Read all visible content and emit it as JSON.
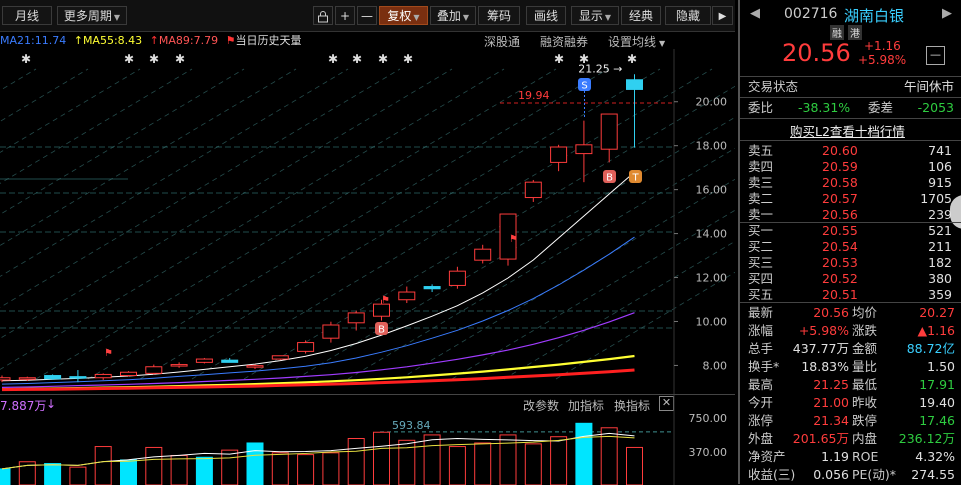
{
  "toolbar": {
    "monthly": "月线",
    "more_periods": "更多周期",
    "lock_icon": "lock-icon",
    "plus": "+",
    "minus": "—",
    "restore": "复权",
    "overlay": "叠加",
    "chips": "筹码",
    "draw": "画线",
    "display": "显示",
    "classic": "经典",
    "hide": "隐藏",
    "collapse": "▶"
  },
  "ma_legend": {
    "ma21": "MA21:11.74",
    "ma55": "MA55:8.43",
    "ma89": "MA89:7.79",
    "history": "当日历史天量",
    "ma21_color": "#3a7cff",
    "ma55_color": "#ffff33",
    "ma89_color": "#ff3333"
  },
  "chart_links": {
    "margin_link": "深股通",
    "financing": "融资融券",
    "set_ma": "设置均线"
  },
  "chart_data": {
    "type": "candlestick",
    "y_ticks": [
      "20.00",
      "18.00",
      "16.00",
      "14.00",
      "12.00",
      "10.00",
      "8.00"
    ],
    "ylim": [
      6.7,
      22.4
    ],
    "annotations": {
      "high_label": "21.25",
      "ref_label": "19.94",
      "mark_s": "S",
      "mark_b": "B",
      "mark_t": "T"
    },
    "candles": [
      {
        "o": 7.34,
        "h": 7.54,
        "l": 7.24,
        "c": 7.44
      },
      {
        "o": 7.39,
        "h": 7.49,
        "l": 7.29,
        "c": 7.44
      },
      {
        "o": 7.54,
        "h": 7.59,
        "l": 7.34,
        "c": 7.39
      },
      {
        "o": 7.49,
        "h": 7.79,
        "l": 7.24,
        "c": 7.44
      },
      {
        "o": 7.44,
        "h": 7.64,
        "l": 7.34,
        "c": 7.59
      },
      {
        "o": 7.54,
        "h": 7.74,
        "l": 7.49,
        "c": 7.69
      },
      {
        "o": 7.64,
        "h": 8.04,
        "l": 7.59,
        "c": 7.94
      },
      {
        "o": 8.04,
        "h": 8.14,
        "l": 7.89,
        "c": 8.04
      },
      {
        "o": 8.14,
        "h": 8.34,
        "l": 8.09,
        "c": 8.29
      },
      {
        "o": 8.24,
        "h": 8.34,
        "l": 8.14,
        "c": 8.14
      },
      {
        "o": 7.94,
        "h": 8.04,
        "l": 7.84,
        "c": 7.99
      },
      {
        "o": 8.29,
        "h": 8.44,
        "l": 8.24,
        "c": 8.44
      },
      {
        "o": 8.64,
        "h": 9.14,
        "l": 8.54,
        "c": 9.04
      },
      {
        "o": 9.24,
        "h": 9.99,
        "l": 9.04,
        "c": 9.84
      },
      {
        "o": 9.94,
        "h": 10.49,
        "l": 9.59,
        "c": 10.39
      },
      {
        "o": 10.24,
        "h": 10.99,
        "l": 10.04,
        "c": 10.79
      },
      {
        "o": 10.99,
        "h": 11.59,
        "l": 10.84,
        "c": 11.34
      },
      {
        "o": 11.59,
        "h": 11.69,
        "l": 11.34,
        "c": 11.49
      },
      {
        "o": 11.64,
        "h": 12.49,
        "l": 11.49,
        "c": 12.29
      },
      {
        "o": 12.79,
        "h": 13.49,
        "l": 12.64,
        "c": 13.29
      },
      {
        "o": 12.84,
        "h": 14.89,
        "l": 12.54,
        "c": 14.89
      },
      {
        "o": 15.64,
        "h": 16.44,
        "l": 15.44,
        "c": 16.34
      },
      {
        "o": 17.24,
        "h": 18.04,
        "l": 16.84,
        "c": 17.94
      },
      {
        "o": 17.64,
        "h": 19.14,
        "l": 16.34,
        "c": 18.04
      },
      {
        "o": 17.84,
        "h": 19.44,
        "l": 17.24,
        "c": 19.44
      },
      {
        "o": 21.0,
        "h": 21.25,
        "l": 17.91,
        "c": 20.56
      }
    ],
    "series": [
      {
        "values": [
          7.3,
          7.33,
          7.37,
          7.41,
          7.46,
          7.52,
          7.6,
          7.7,
          7.82,
          7.94,
          8.06,
          8.22,
          8.42,
          8.68,
          9.0,
          9.38,
          9.8,
          10.24,
          10.72,
          11.3,
          11.98,
          12.8,
          13.8,
          14.8,
          15.8,
          16.8
        ]
      },
      {
        "values": [
          7.15,
          7.18,
          7.22,
          7.26,
          7.3,
          7.35,
          7.42,
          7.5,
          7.58,
          7.66,
          7.74,
          7.84,
          7.96,
          8.12,
          8.34,
          8.6,
          8.9,
          9.24,
          9.6,
          10.02,
          10.5,
          11.04,
          11.66,
          12.34,
          13.06,
          13.84
        ]
      },
      {
        "values": [
          7.0,
          7.02,
          7.05,
          7.08,
          7.11,
          7.14,
          7.18,
          7.22,
          7.27,
          7.32,
          7.37,
          7.43,
          7.5,
          7.58,
          7.68,
          7.8,
          7.94,
          8.1,
          8.28,
          8.48,
          8.7,
          8.96,
          9.26,
          9.6,
          9.98,
          10.4
        ]
      },
      {
        "values": [
          6.92,
          6.93,
          6.95,
          6.97,
          6.99,
          7.01,
          7.03,
          7.06,
          7.09,
          7.12,
          7.15,
          7.19,
          7.23,
          7.28,
          7.33,
          7.39,
          7.46,
          7.54,
          7.63,
          7.72,
          7.82,
          7.93,
          8.04,
          8.16,
          8.29,
          8.43
        ]
      },
      {
        "values": [
          6.9,
          6.91,
          6.92,
          6.93,
          6.95,
          6.96,
          6.98,
          7.0,
          7.02,
          7.04,
          7.06,
          7.09,
          7.12,
          7.15,
          7.18,
          7.22,
          7.26,
          7.3,
          7.35,
          7.4,
          7.46,
          7.52,
          7.58,
          7.64,
          7.71,
          7.79
        ]
      }
    ]
  },
  "volume": {
    "label": "7.887万",
    "peak_label": "593.84",
    "ticks": [
      "750.00",
      "370.00"
    ],
    "links": {
      "params": "改参数",
      "add_indicator": "加指标",
      "switch_indicator": "换指标"
    },
    "bars": [
      {
        "v": 180,
        "up": false
      },
      {
        "v": 260,
        "up": true
      },
      {
        "v": 240,
        "up": false
      },
      {
        "v": 200,
        "up": true
      },
      {
        "v": 430,
        "up": true
      },
      {
        "v": 280,
        "up": false
      },
      {
        "v": 420,
        "up": true
      },
      {
        "v": 330,
        "up": true
      },
      {
        "v": 310,
        "up": false
      },
      {
        "v": 390,
        "up": true
      },
      {
        "v": 470,
        "up": false
      },
      {
        "v": 360,
        "up": true
      },
      {
        "v": 340,
        "up": true
      },
      {
        "v": 360,
        "up": true
      },
      {
        "v": 520,
        "up": true
      },
      {
        "v": 590,
        "up": true
      },
      {
        "v": 500,
        "up": true
      },
      {
        "v": 560,
        "up": true
      },
      {
        "v": 430,
        "up": true
      },
      {
        "v": 470,
        "up": true
      },
      {
        "v": 560,
        "up": true
      },
      {
        "v": 460,
        "up": true
      },
      {
        "v": 540,
        "up": true
      },
      {
        "v": 690,
        "up": false
      },
      {
        "v": 640,
        "up": true
      },
      {
        "v": 420,
        "up": true
      }
    ]
  },
  "quote": {
    "code": "002716",
    "name": "湖南白银",
    "badge1": "融",
    "badge2": "港",
    "price": "20.56",
    "change": "+1.16",
    "change_pct": "+5.98%",
    "minus_btn": "—",
    "status_label": "交易状态",
    "status_value": "午间休市",
    "wb_label": "委比",
    "wb_value": "-38.31%",
    "wc_label": "委差",
    "wc_value": "-2053",
    "l2_link": "购买L2查看十档行情",
    "asks": [
      {
        "name": "卖五",
        "price": "20.60",
        "vol": "741"
      },
      {
        "name": "卖四",
        "price": "20.59",
        "vol": "106"
      },
      {
        "name": "卖三",
        "price": "20.58",
        "vol": "915"
      },
      {
        "name": "卖二",
        "price": "20.57",
        "vol": "1705"
      },
      {
        "name": "卖一",
        "price": "20.56",
        "vol": "239"
      }
    ],
    "bids": [
      {
        "name": "买一",
        "price": "20.55",
        "vol": "521"
      },
      {
        "name": "买二",
        "price": "20.54",
        "vol": "211"
      },
      {
        "name": "买三",
        "price": "20.53",
        "vol": "182"
      },
      {
        "name": "买四",
        "price": "20.52",
        "vol": "380"
      },
      {
        "name": "买五",
        "price": "20.51",
        "vol": "359"
      }
    ],
    "stats": {
      "latest_l": "最新",
      "latest_v": "20.56",
      "avg_l": "均价",
      "avg_v": "20.27",
      "pct_l": "涨幅",
      "pct_v": "+5.98%",
      "chg_l": "涨跌",
      "chg_v": "▲1.16",
      "hand_l": "总手",
      "hand_v": "437.77万",
      "amt_l": "金额",
      "amt_v": "88.72亿",
      "turn_l": "换手*",
      "turn_v": "18.83%",
      "vr_l": "量比",
      "vr_v": "1.50",
      "high_l": "最高",
      "high_v": "21.25",
      "low_l": "最低",
      "low_v": "17.91",
      "open_l": "今开",
      "open_v": "21.00",
      "prev_l": "昨收",
      "prev_v": "19.40",
      "up_l": "涨停",
      "up_v": "21.34",
      "down_l": "跌停",
      "down_v": "17.46",
      "out_l": "外盘",
      "out_v": "201.65万",
      "in_l": "内盘",
      "in_v": "236.12万",
      "nav_l": "净资产",
      "nav_v": "1.19",
      "roe_l": "ROE",
      "roe_v": "4.32%",
      "eps_l": "收益(三)",
      "eps_v": "0.056",
      "pe_l": "PE(动)*",
      "pe_v": "274.55"
    }
  }
}
